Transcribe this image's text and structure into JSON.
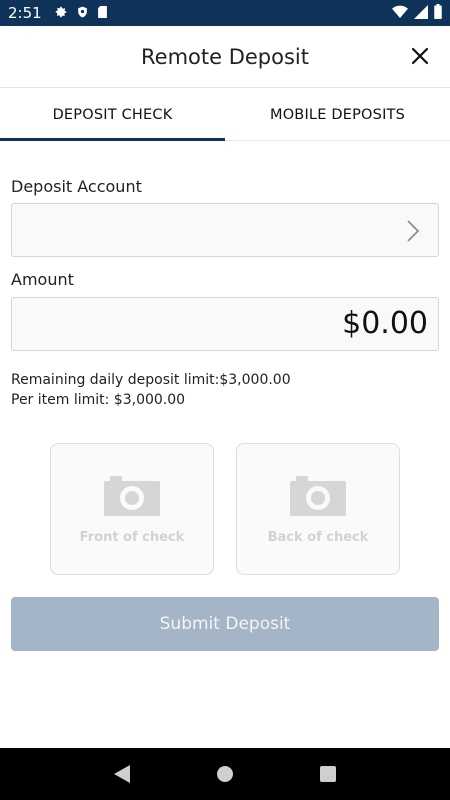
{
  "status_bar": {
    "time": "2:51"
  },
  "app_bar": {
    "title": "Remote Deposit"
  },
  "tabs": [
    {
      "label": "DEPOSIT CHECK",
      "active": true
    },
    {
      "label": "MOBILE DEPOSITS",
      "active": false
    }
  ],
  "form": {
    "account_label": "Deposit Account",
    "account_value": "",
    "amount_label": "Amount",
    "amount_value": "$0.00",
    "daily_limit_text": "Remaining daily deposit limit:$3,000.00",
    "item_limit_text": "Per item limit: $3,000.00"
  },
  "photos": {
    "front_label": "Front of check",
    "back_label": "Back of check"
  },
  "submit_label": "Submit Deposit",
  "colors": {
    "status_bar": "#0f3358",
    "tab_indicator": "#0f3358",
    "submit_disabled": "#a3b5c6"
  }
}
